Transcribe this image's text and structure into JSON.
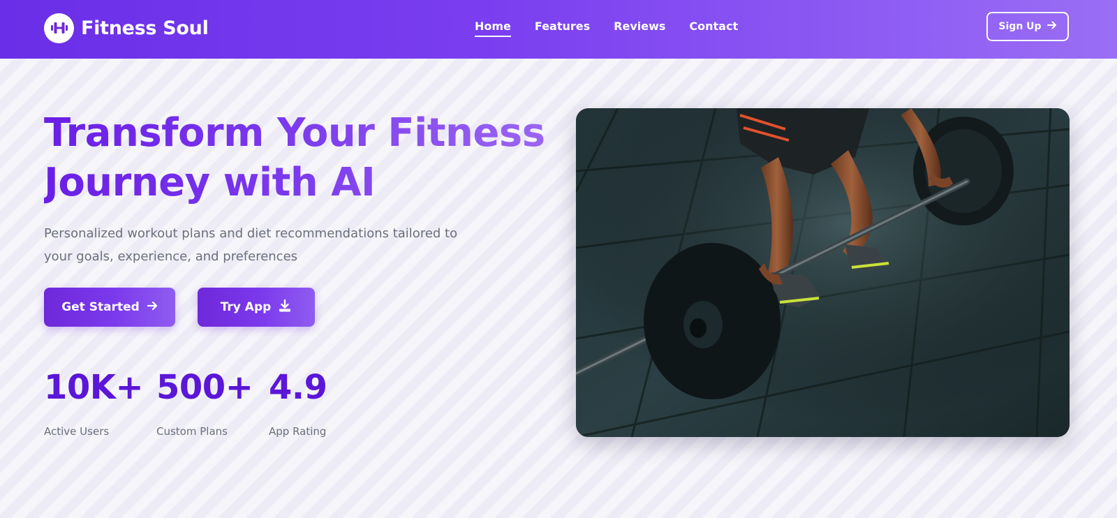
{
  "brand": {
    "name": "Fitness Soul",
    "logo_icon": "dumbbell-icon"
  },
  "nav": {
    "items": [
      {
        "label": "Home",
        "active": true
      },
      {
        "label": "Features",
        "active": false
      },
      {
        "label": "Reviews",
        "active": false
      },
      {
        "label": "Contact",
        "active": false
      }
    ],
    "signup_label": "Sign Up"
  },
  "hero": {
    "title_line1": "Transform Your Fitness",
    "title_line2": "Journey with AI",
    "subtitle": "Personalized workout plans and diet recommendations tailored to your goals, experience, and preferences",
    "cta_primary": "Get Started",
    "cta_secondary": "Try App",
    "image_alt": "Person lifting a barbell on a gym floor"
  },
  "stats": [
    {
      "value": "10K+",
      "label": "Active Users"
    },
    {
      "value": "500+",
      "label": "Custom Plans"
    },
    {
      "value": "4.9",
      "label": "App Rating"
    }
  ],
  "colors": {
    "header_start": "#6a2ee8",
    "header_end": "#9a6ef5",
    "accent": "#5b16d8",
    "background": "#f1f0f8",
    "muted_text": "#6a6f7a"
  }
}
